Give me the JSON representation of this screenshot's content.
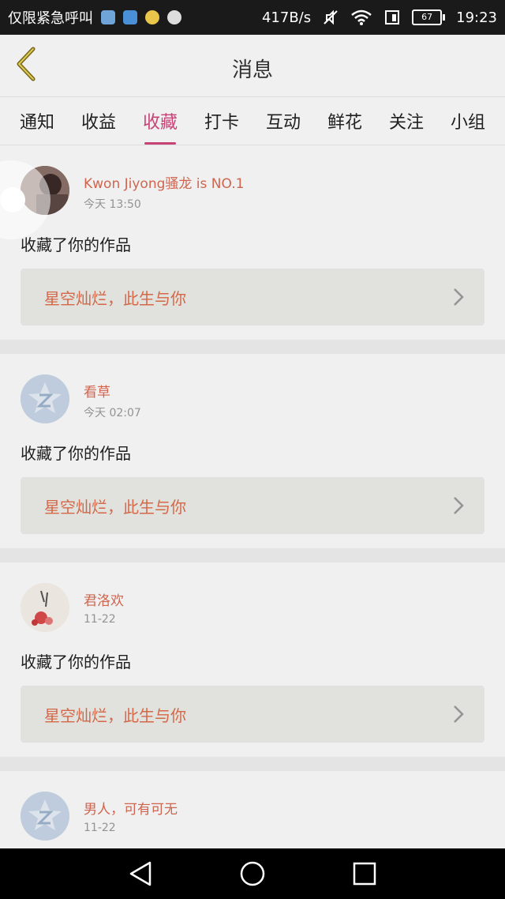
{
  "status_bar": {
    "carrier": "仅限紧急呼叫",
    "network_speed": "417B/s",
    "battery": "67",
    "time": "19:23"
  },
  "header": {
    "title": "消息"
  },
  "tabs": [
    {
      "label": "通知"
    },
    {
      "label": "收益"
    },
    {
      "label": "收藏",
      "active": true
    },
    {
      "label": "打卡"
    },
    {
      "label": "互动"
    },
    {
      "label": "鲜花"
    },
    {
      "label": "关注"
    },
    {
      "label": "小组"
    }
  ],
  "messages": [
    {
      "username": "Kwon Jiyong骚龙 is NO.1",
      "time": "今天 13:50",
      "action": "收藏了你的作品",
      "work_title": "星空灿烂，此生与你"
    },
    {
      "username": "看草",
      "time": "今天 02:07",
      "action": "收藏了你的作品",
      "work_title": "星空灿烂，此生与你"
    },
    {
      "username": "君洛欢",
      "time": "11-22",
      "action": "收藏了你的作品",
      "work_title": "星空灿烂，此生与你"
    },
    {
      "username": "男人，可有可无",
      "time": "11-22"
    }
  ],
  "colors": {
    "accent": "#d0467a",
    "username": "#d86a52",
    "work_title": "#dd6d4a"
  }
}
